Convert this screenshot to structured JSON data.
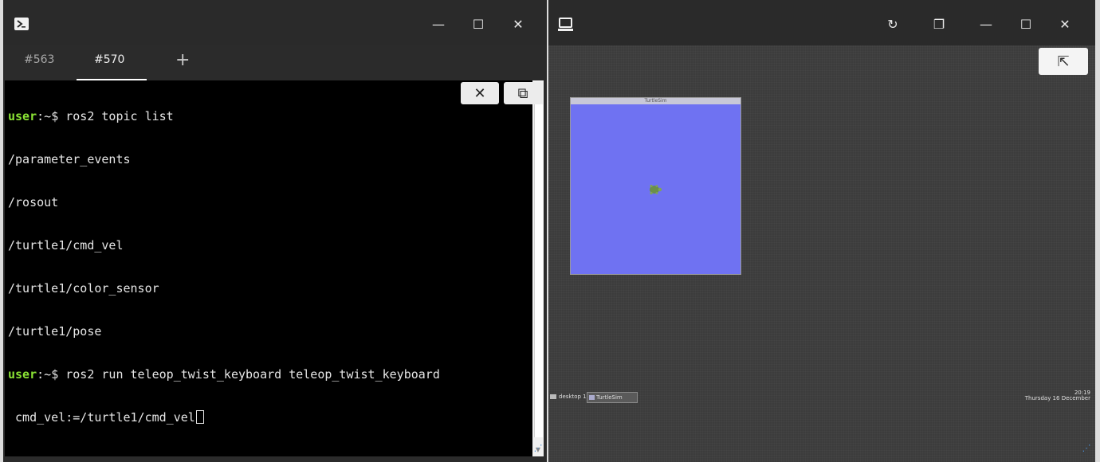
{
  "left_window": {
    "titlebar_icon": "powershell-icon",
    "controls": {
      "minimize": "—",
      "maximize": "☐",
      "close": "✕"
    },
    "tabs": [
      {
        "label": "#563",
        "active": false
      },
      {
        "label": "#570",
        "active": true
      }
    ],
    "add_tab_label": "+",
    "terminal": {
      "line1": {
        "user": "user",
        "path": ":~",
        "cmd": "$ ros2 topic list"
      },
      "output": [
        "/parameter_events",
        "/rosout",
        "/turtle1/cmd_vel",
        "/turtle1/color_sensor",
        "/turtle1/pose"
      ],
      "line7": {
        "user": "user",
        "path": ":~",
        "cmd": "$ ros2 run teleop_twist_keyboard teleop_twist_keyboard"
      },
      "line8": " cmd_vel:=/turtle1/cmd_vel"
    },
    "overlay": {
      "close_label": "✕",
      "restore_label": "⧉"
    }
  },
  "right_window": {
    "titlebar_icon": "computer-icon",
    "controls": {
      "refresh": "↻",
      "restore": "❐",
      "minimize": "—",
      "maximize": "☐",
      "close": "✕"
    },
    "fullscreen_button": "⇱",
    "turtlesim": {
      "title": "TurtleSim"
    },
    "taskbar": {
      "desktop_label": "desktop 1",
      "app_label": "TurtleSim",
      "clock_time": "20:19",
      "clock_date": "Thursday 16 December"
    }
  },
  "colors": {
    "terminal_bg": "#000000",
    "prompt_user": "#8ae234",
    "turtlesim_bg": "#6f72f2"
  }
}
